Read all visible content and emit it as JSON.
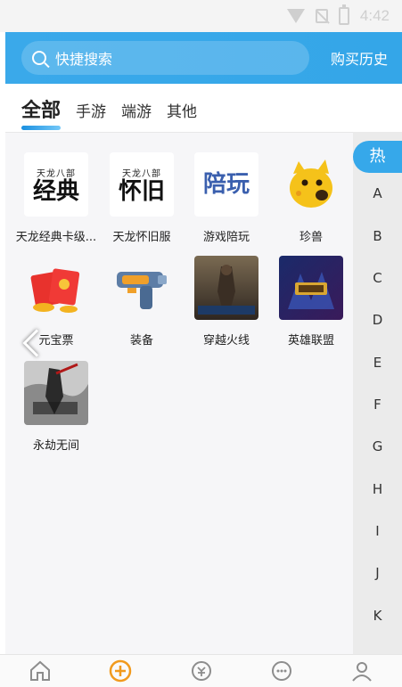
{
  "status": {
    "time": "4:42"
  },
  "header": {
    "search_placeholder": "快捷搜索",
    "history_label": "购买历史",
    "accent": "#36a8ea"
  },
  "tabs": [
    {
      "label": "全部",
      "active": true
    },
    {
      "label": "手游",
      "active": false
    },
    {
      "label": "端游",
      "active": false
    },
    {
      "label": "其他",
      "active": false
    }
  ],
  "items": [
    {
      "label": "天龙经典卡级...",
      "icon": "tianlong-classic-calligraphy",
      "caption_small": "天龙八部",
      "caption_big": "经典"
    },
    {
      "label": "天龙怀旧服",
      "icon": "tianlong-nostalgia-calligraphy",
      "caption_small": "天龙八部",
      "caption_big": "怀旧"
    },
    {
      "label": "游戏陪玩",
      "icon": "game-companion-calligraphy",
      "caption_big": "陪玩"
    },
    {
      "label": "珍兽",
      "icon": "yellow-pet-icon"
    },
    {
      "label": "元宝票",
      "icon": "red-envelope-icon"
    },
    {
      "label": "装备",
      "icon": "blaster-gun-icon"
    },
    {
      "label": "穿越火线",
      "icon": "crossfire-cover"
    },
    {
      "label": "英雄联盟",
      "icon": "league-of-legends-cover"
    },
    {
      "label": "永劫无间",
      "icon": "naraka-cover"
    }
  ],
  "alphabet_index": {
    "hot": "热",
    "letters": [
      "A",
      "B",
      "C",
      "D",
      "E",
      "F",
      "G",
      "H",
      "I",
      "J",
      "K"
    ]
  },
  "bottom_nav": [
    {
      "name": "home",
      "active": false
    },
    {
      "name": "add",
      "active": true
    },
    {
      "name": "exchange",
      "active": false
    },
    {
      "name": "message",
      "active": false
    },
    {
      "name": "profile",
      "active": false
    }
  ]
}
